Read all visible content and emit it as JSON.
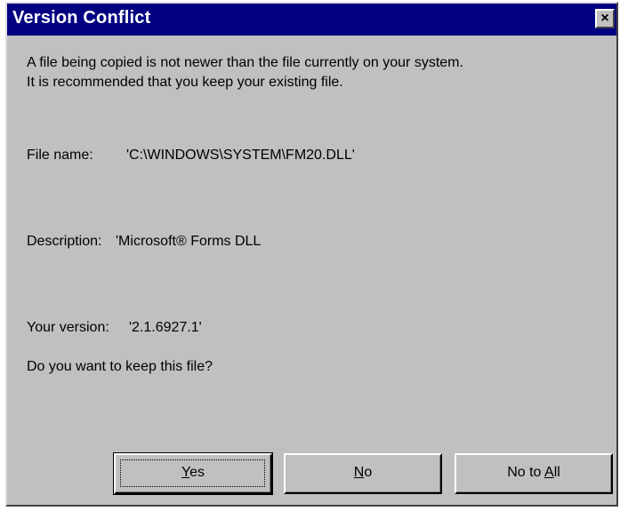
{
  "window": {
    "title": "Version Conflict",
    "close_glyph": "×"
  },
  "message": {
    "line1": "A file being copied is not newer than the file currently on your system.",
    "line2": "It is recommended that you keep your existing file."
  },
  "file": {
    "name_label": "File name:",
    "name_value": "'C:\\WINDOWS\\SYSTEM\\FM20.DLL'",
    "description_label": "Description:",
    "description_value": "'Microsoft® Forms DLL",
    "version_label": "Your version:",
    "version_value": "'2.1.6927.1'"
  },
  "question": "Do you want to keep this file?",
  "buttons": {
    "yes": {
      "underline": "Y",
      "rest": "es"
    },
    "no": {
      "underline": "N",
      "rest": "o"
    },
    "no_to_all": {
      "prefix": "No to ",
      "underline": "A",
      "rest": "ll"
    }
  },
  "colors": {
    "titlebar": "#000080",
    "face": "#c0c0c0"
  }
}
